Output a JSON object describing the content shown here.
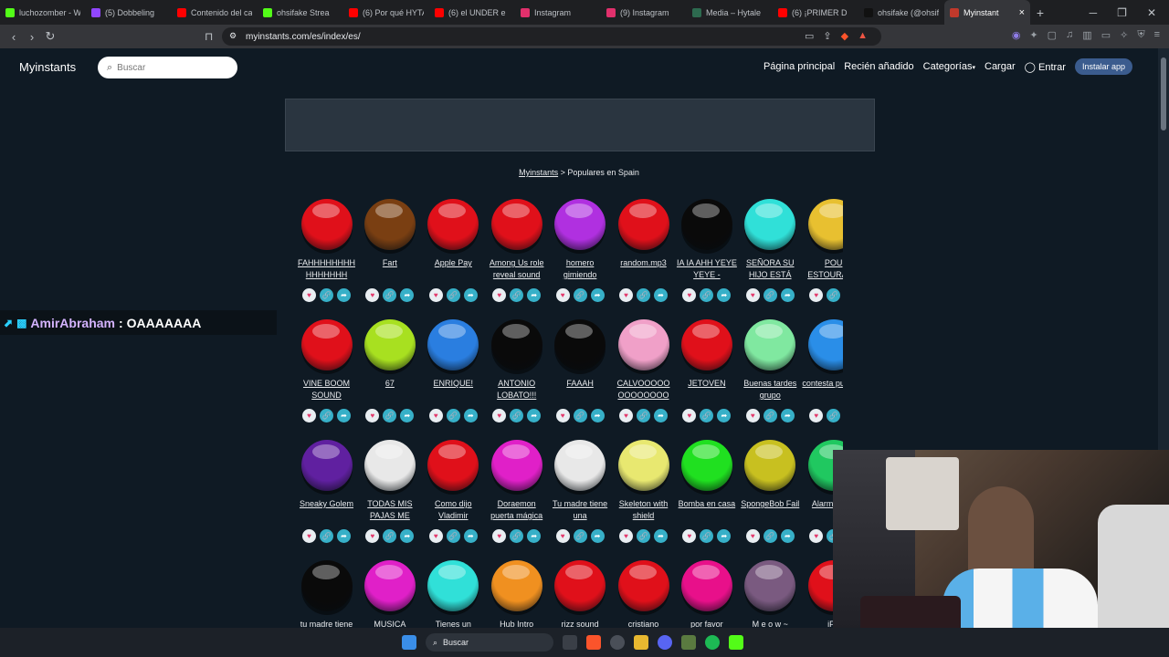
{
  "browser": {
    "tabs": [
      {
        "title": "luchozomber - W",
        "color": "#53fc18"
      },
      {
        "title": "(5) Dobbeling",
        "color": "#9146ff"
      },
      {
        "title": "Contenido del ca",
        "color": "#ff0000"
      },
      {
        "title": "ohsifake Strea",
        "color": "#53fc18"
      },
      {
        "title": "(6) Por qué HYTA",
        "color": "#ff0000"
      },
      {
        "title": "(6) el UNDER e",
        "color": "#ff0000"
      },
      {
        "title": "Instagram",
        "color": "#e1306c"
      },
      {
        "title": "(9) Instagram",
        "color": "#e1306c"
      },
      {
        "title": "Media – Hytale",
        "color": "#2d6a4f"
      },
      {
        "title": "(6) ¡PRIMER D",
        "color": "#ff0000"
      },
      {
        "title": "ohsifake (@ohsif",
        "color": "#111111"
      },
      {
        "title": "Myinstant",
        "color": "#c0392b",
        "active": true
      }
    ],
    "url": "myinstants.com/es/index/es/"
  },
  "site": {
    "logo": "Myinstants",
    "search_placeholder": "Buscar",
    "menu": {
      "home": "Página principal",
      "recent": "Recién añadido",
      "categories": "Categorías",
      "upload": "Cargar",
      "login": "Entrar",
      "install": "Instalar app"
    },
    "breadcrumb": {
      "home": "Myinstants",
      "sep": " > ",
      "current": "Populares en Spain"
    }
  },
  "sounds": [
    {
      "label": "FAHHHHHHHH HHHHHHH",
      "color": "#e0101a"
    },
    {
      "label": "Fart",
      "color": "#7a3f12"
    },
    {
      "label": "Apple Pay",
      "color": "#e0101a"
    },
    {
      "label": "Among Us role reveal sound",
      "color": "#e0101a"
    },
    {
      "label": "homero gimiendo",
      "color": "#b030e0"
    },
    {
      "label": "random.mp3",
      "color": "#e0101a"
    },
    {
      "label": "IA IA AHH YEYE YEYE -",
      "color": "#0a0a0a"
    },
    {
      "label": "SEÑORA SU HIJO ESTÁ",
      "color": "#30e0d8"
    },
    {
      "label": "POU ESTOURADO",
      "color": "#e8c030"
    },
    {
      "label": "VINE BOOM SOUND",
      "color": "#e0101a"
    },
    {
      "label": "67",
      "color": "#a8e020"
    },
    {
      "label": "ENRIQUE!",
      "color": "#2a7ee0"
    },
    {
      "label": "ANTONIO LOBATO!!!",
      "color": "#0a0a0a"
    },
    {
      "label": "FAAAH",
      "color": "#0a0a0a"
    },
    {
      "label": "CALVOOOOO OOOOOOOO",
      "color": "#f0a0c8"
    },
    {
      "label": "JETOVEN",
      "color": "#e0101a"
    },
    {
      "label": "Buenas tardes grupo",
      "color": "#80e8a0"
    },
    {
      "label": "contesta puñetas",
      "color": "#2a8ee8"
    },
    {
      "label": "Sneaky Golem",
      "color": "#6020a0"
    },
    {
      "label": "TODAS MIS PAJAS ME",
      "color": "#e8e8e8"
    },
    {
      "label": "Como dijo Vladimir",
      "color": "#e0101a"
    },
    {
      "label": "Doraemon puerta mágica",
      "color": "#e020c8"
    },
    {
      "label": "Tu madre tiene una",
      "color": "#e8e8e8"
    },
    {
      "label": "Skeleton with shield",
      "color": "#e8e870"
    },
    {
      "label": "Bomba en casa",
      "color": "#20e020"
    },
    {
      "label": "SpongeBob Fail",
      "color": "#c8c020"
    },
    {
      "label": "Alarm Auror",
      "color": "#20c860"
    },
    {
      "label": "tu madre tiene",
      "color": "#0a0a0a"
    },
    {
      "label": "MUSICA",
      "color": "#e020c8"
    },
    {
      "label": "Tienes un",
      "color": "#30e0d8"
    },
    {
      "label": "Hub Intro",
      "color": "#f09020"
    },
    {
      "label": "rizz sound",
      "color": "#e0101a"
    },
    {
      "label": "cristiano",
      "color": "#e0101a"
    },
    {
      "label": "por favor",
      "color": "#e8108a"
    },
    {
      "label": "M e o w ~",
      "color": "#7a5a80"
    },
    {
      "label": "iPh",
      "color": "#e0101a"
    }
  ],
  "chat": {
    "user": "AmirAbraham",
    "sep": " : ",
    "message": "OAAAAAAA"
  },
  "taskbar": {
    "search": "Buscar"
  }
}
